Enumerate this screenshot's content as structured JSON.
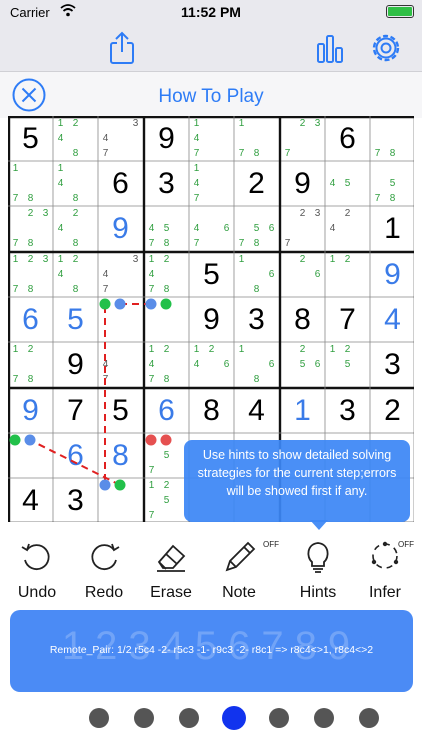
{
  "status_bar": {
    "carrier": "Carrier",
    "time": "11:52 PM"
  },
  "toolbar": {
    "icons": [
      "share-icon",
      "chart-icon",
      "gear-icon"
    ]
  },
  "header": {
    "title": "How To Play",
    "close_icon": "close-circle-icon"
  },
  "colors": {
    "accent": "#2e7cf6",
    "given": "#000000",
    "filled": "#3a7be8",
    "candidate": "#2f9e3f",
    "chain": "#e02020",
    "dot_green": "#22c04a",
    "dot_blue": "#5a8de8",
    "dot_red": "#e55050"
  },
  "board": {
    "cells": [
      [
        {
          "v": "5",
          "t": "given"
        },
        {
          "c": [
            "1",
            "2",
            "4",
            "8"
          ]
        },
        {
          "cg": [
            "3",
            "4",
            "7"
          ]
        },
        {
          "v": "9",
          "t": "given"
        },
        {
          "c": [
            "1",
            "4",
            "7"
          ]
        },
        {
          "c": [
            "1",
            "7",
            "8"
          ]
        },
        {
          "c": [
            "2",
            "3",
            "7"
          ]
        },
        {
          "v": "6",
          "t": "given"
        },
        {
          "c": [
            "7",
            "8"
          ]
        }
      ],
      [
        {
          "c": [
            "1",
            "7",
            "8"
          ]
        },
        {
          "c": [
            "1",
            "4",
            "8"
          ]
        },
        {
          "v": "6",
          "t": "given"
        },
        {
          "v": "3",
          "t": "given"
        },
        {
          "c": [
            "1",
            "4",
            "7"
          ]
        },
        {
          "v": "2",
          "t": "given"
        },
        {
          "v": "9",
          "t": "given"
        },
        {
          "c": [
            "4",
            "5"
          ]
        },
        {
          "c": [
            "5",
            "7",
            "8"
          ]
        }
      ],
      [
        {
          "c": [
            "2",
            "3",
            "7",
            "8"
          ]
        },
        {
          "c": [
            "2",
            "4",
            "8"
          ]
        },
        {
          "v": "9",
          "t": "filled"
        },
        {
          "c": [
            "4",
            "5",
            "7",
            "8"
          ]
        },
        {
          "c": [
            "4",
            "6",
            "7"
          ]
        },
        {
          "c": [
            "5",
            "6",
            "7",
            "8"
          ]
        },
        {
          "cg": [
            "2",
            "3",
            "7"
          ]
        },
        {
          "cg": [
            "2",
            "4"
          ]
        },
        {
          "v": "1",
          "t": "given"
        }
      ],
      [
        {
          "c": [
            "1",
            "2",
            "3",
            "7",
            "8"
          ]
        },
        {
          "c": [
            "1",
            "2",
            "4",
            "8"
          ]
        },
        {
          "cg": [
            "3",
            "4",
            "7"
          ]
        },
        {
          "c": [
            "1",
            "2",
            "4",
            "7",
            "8"
          ]
        },
        {
          "v": "5",
          "t": "given"
        },
        {
          "c": [
            "1",
            "6",
            "8"
          ]
        },
        {
          "c": [
            "2",
            "6"
          ]
        },
        {
          "c": [
            "1",
            "2"
          ]
        },
        {
          "v": "9",
          "t": "filled"
        }
      ],
      [
        {
          "v": "6",
          "t": "filled"
        },
        {
          "v": "5",
          "t": "filled"
        },
        {
          "c": []
        },
        {
          "c": []
        },
        {
          "v": "9",
          "t": "given"
        },
        {
          "v": "3",
          "t": "given"
        },
        {
          "v": "8",
          "t": "given"
        },
        {
          "v": "7",
          "t": "given"
        },
        {
          "v": "4",
          "t": "filled"
        }
      ],
      [
        {
          "c": [
            "1",
            "2",
            "7",
            "8"
          ]
        },
        {
          "v": "9",
          "t": "given"
        },
        {
          "cg": [
            "4",
            "7"
          ]
        },
        {
          "c": [
            "1",
            "2",
            "4",
            "7",
            "8"
          ]
        },
        {
          "c": [
            "1",
            "2",
            "4",
            "6"
          ]
        },
        {
          "c": [
            "1",
            "6",
            "8"
          ]
        },
        {
          "c": [
            "2",
            "5",
            "6"
          ]
        },
        {
          "c": [
            "1",
            "2",
            "5"
          ]
        },
        {
          "v": "3",
          "t": "given"
        }
      ],
      [
        {
          "v": "9",
          "t": "filled"
        },
        {
          "v": "7",
          "t": "given"
        },
        {
          "v": "5",
          "t": "given"
        },
        {
          "v": "6",
          "t": "filled"
        },
        {
          "v": "8",
          "t": "given"
        },
        {
          "v": "4",
          "t": "given"
        },
        {
          "v": "1",
          "t": "filled"
        },
        {
          "v": "3",
          "t": "given"
        },
        {
          "v": "2",
          "t": "given"
        }
      ],
      [
        {
          "c": []
        },
        {
          "v": "6",
          "t": "filled"
        },
        {
          "v": "8",
          "t": "filled"
        },
        {
          "c": [
            "5",
            "7"
          ]
        },
        {
          "c": []
        },
        {
          "c": []
        },
        {
          "c": []
        },
        {
          "c": []
        },
        {
          "c": []
        }
      ],
      [
        {
          "v": "4",
          "t": "given"
        },
        {
          "v": "3",
          "t": "given"
        },
        {
          "c": []
        },
        {
          "c": [
            "1",
            "2",
            "5",
            "7"
          ]
        },
        {
          "c": []
        },
        {
          "c": []
        },
        {
          "c": []
        },
        {
          "c": []
        },
        {
          "c": []
        }
      ]
    ]
  },
  "tooltip": {
    "text": "Use hints to show detailed solving strategies for the current step;errors will be showed first if any."
  },
  "tools": [
    {
      "label": "Undo",
      "icon": "undo-icon"
    },
    {
      "label": "Redo",
      "icon": "redo-icon"
    },
    {
      "label": "Erase",
      "icon": "eraser-icon"
    },
    {
      "label": "Note",
      "icon": "pencil-icon",
      "badge": "OFF"
    },
    {
      "label": "Hints",
      "icon": "lightbulb-icon"
    },
    {
      "label": "Infer",
      "icon": "infer-icon",
      "badge": "OFF"
    }
  ],
  "hint_panel": {
    "text": "Remote_Pair: 1/2 r5c4 -2- r5c3 -1- r9c3 -2- r8c1 => r8c4<>1, r8c4<>2",
    "background_digits": "123456789"
  },
  "pagination": {
    "count": 7,
    "active_index": 3
  }
}
